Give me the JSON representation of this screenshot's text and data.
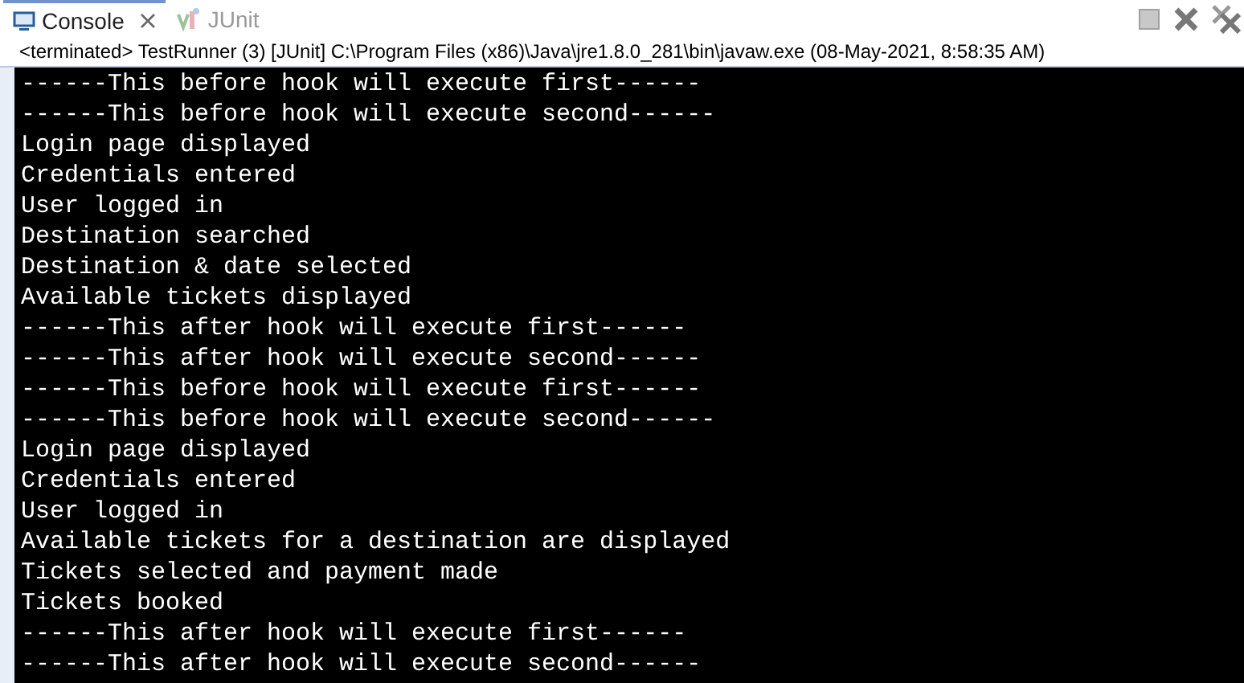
{
  "tabs": [
    {
      "label": "Console",
      "selected": true,
      "closable": true
    },
    {
      "label": "JUnit",
      "selected": false,
      "closable": false
    }
  ],
  "status_line": "<terminated> TestRunner (3) [JUnit] C:\\Program Files (x86)\\Java\\jre1.8.0_281\\bin\\javaw.exe (08-May-2021, 8:58:35 AM)",
  "console_lines": [
    "------This before hook will execute first------",
    "------This before hook will execute second------",
    "Login page displayed",
    "Credentials entered",
    "User logged in",
    "Destination searched",
    "Destination & date selected",
    "Available tickets displayed",
    "------This after hook will execute first------",
    "------This after hook will execute second------",
    "------This before hook will execute first------",
    "------This before hook will execute second------",
    "Login page displayed",
    "Credentials entered",
    "User logged in",
    "Available tickets for a destination are displayed",
    "Tickets selected and payment made",
    "Tickets booked",
    "------This after hook will execute first------",
    "------This after hook will execute second------"
  ]
}
